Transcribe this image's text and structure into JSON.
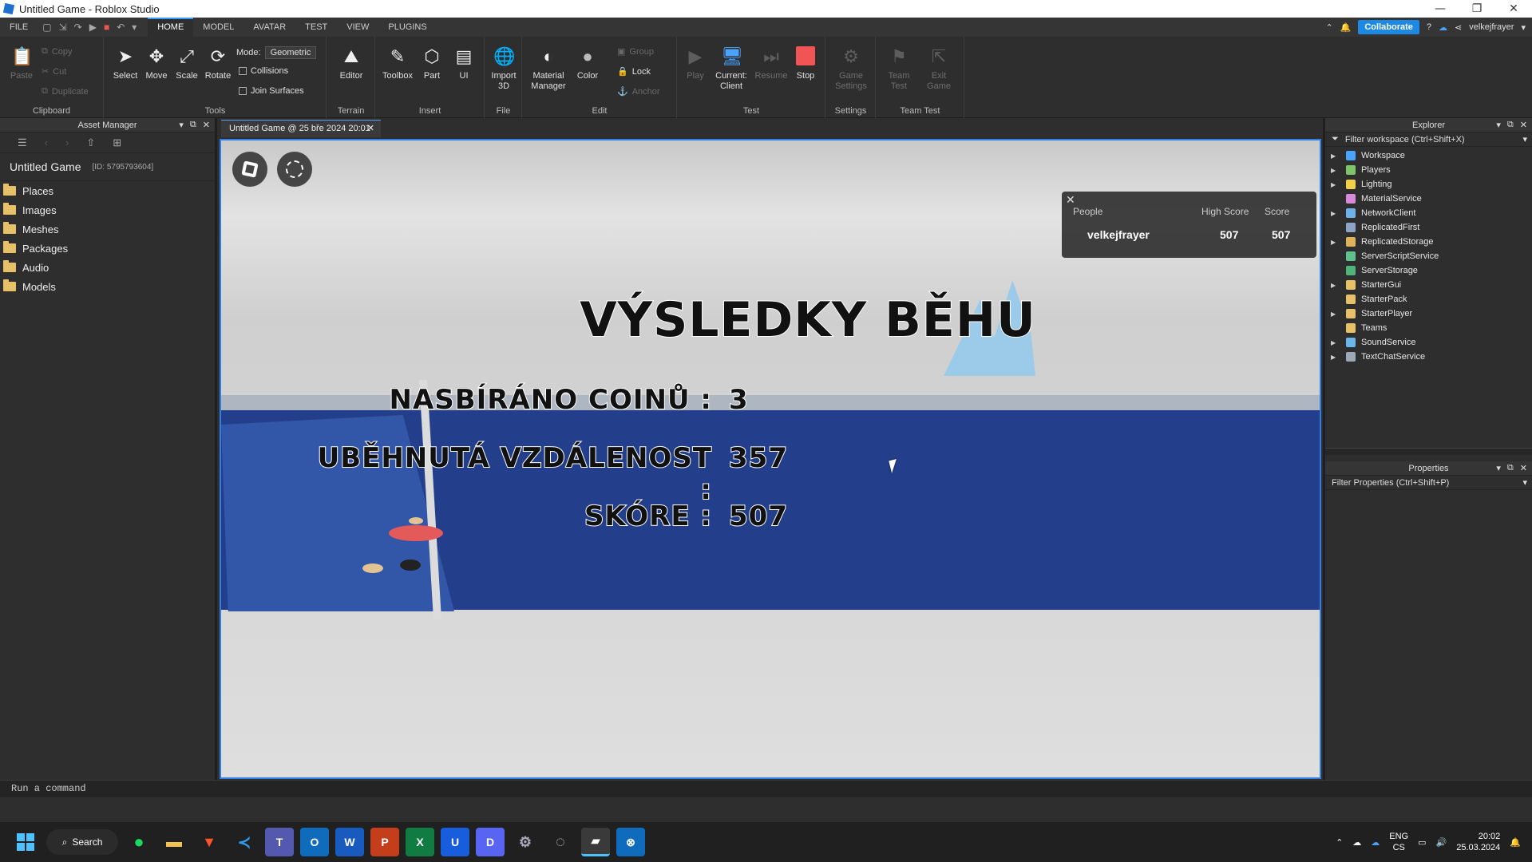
{
  "window": {
    "title": "Untitled Game - Roblox Studio",
    "min": "—",
    "max": "❐",
    "close": "✕"
  },
  "menu": {
    "file": "FILE",
    "tabs": [
      "HOME",
      "MODEL",
      "AVATAR",
      "TEST",
      "VIEW",
      "PLUGINS"
    ],
    "collaborate": "Collaborate",
    "username": "velkejfrayer"
  },
  "ribbon": {
    "clipboard": {
      "label": "Clipboard",
      "paste": "Paste",
      "copy": "Copy",
      "cut": "Cut",
      "duplicate": "Duplicate"
    },
    "tools": {
      "label": "Tools",
      "select": "Select",
      "move": "Move",
      "scale": "Scale",
      "rotate": "Rotate",
      "mode_label": "Mode:",
      "mode_value": "Geometric",
      "collisions": "Collisions",
      "join_surfaces": "Join Surfaces"
    },
    "terrain": {
      "label": "Terrain",
      "editor": "Editor"
    },
    "insert": {
      "label": "Insert",
      "toolbox": "Toolbox",
      "part": "Part",
      "ui": "UI"
    },
    "file": {
      "label": "File",
      "import3d_1": "Import",
      "import3d_2": "3D"
    },
    "edit": {
      "label": "Edit",
      "material1": "Material",
      "material2": "Manager",
      "color": "Color",
      "group": "Group",
      "lock": "Lock",
      "anchor": "Anchor"
    },
    "test": {
      "label": "Test",
      "play": "Play",
      "current1": "Current:",
      "current2": "Client",
      "resume": "Resume",
      "stop": "Stop"
    },
    "settings": {
      "label": "Settings",
      "game1": "Game",
      "game2": "Settings"
    },
    "teamtest": {
      "label": "Team Test",
      "team1": "Team",
      "team2": "Test",
      "exit1": "Exit",
      "exit2": "Game"
    }
  },
  "asset_manager": {
    "title": "Asset Manager",
    "game_name": "Untitled Game",
    "game_id": "[ID: 5795793604]",
    "folders": [
      "Places",
      "Images",
      "Meshes",
      "Packages",
      "Audio",
      "Models"
    ]
  },
  "doc_tab": {
    "label": "Untitled Game @ 25 bře 2024 20:01"
  },
  "game": {
    "title": "VÝSLEDKY BĚHU",
    "stats": [
      {
        "label": "NASBÍRÁNO COINŮ :",
        "value": "3"
      },
      {
        "label": "UBĚHNUTÁ VZDÁLENOST :",
        "value": "357"
      },
      {
        "label": "SKÓRE :",
        "value": "507"
      }
    ],
    "leaderboard": {
      "headers": [
        "People",
        "High Score",
        "Score"
      ],
      "rows": [
        {
          "name": "velkejfrayer",
          "high": "507",
          "score": "507"
        }
      ]
    }
  },
  "explorer": {
    "title": "Explorer",
    "filter": "Filter workspace (Ctrl+Shift+X)",
    "items": [
      {
        "name": "Workspace",
        "arrow": true,
        "color": "#4aa3ff"
      },
      {
        "name": "Players",
        "arrow": true,
        "color": "#7fc46a"
      },
      {
        "name": "Lighting",
        "arrow": true,
        "color": "#f2d04b"
      },
      {
        "name": "MaterialService",
        "arrow": false,
        "color": "#d68ad9"
      },
      {
        "name": "NetworkClient",
        "arrow": true,
        "color": "#6fb0e8"
      },
      {
        "name": "ReplicatedFirst",
        "arrow": false,
        "color": "#8fa3c7"
      },
      {
        "name": "ReplicatedStorage",
        "arrow": true,
        "color": "#e0b35a"
      },
      {
        "name": "ServerScriptService",
        "arrow": false,
        "color": "#5fc28c"
      },
      {
        "name": "ServerStorage",
        "arrow": false,
        "color": "#4fb37a"
      },
      {
        "name": "StarterGui",
        "arrow": true,
        "color": "#e7c06a"
      },
      {
        "name": "StarterPack",
        "arrow": false,
        "color": "#e7c06a"
      },
      {
        "name": "StarterPlayer",
        "arrow": true,
        "color": "#e7c06a"
      },
      {
        "name": "Teams",
        "arrow": false,
        "color": "#e7c06a"
      },
      {
        "name": "SoundService",
        "arrow": true,
        "color": "#6bb6e6"
      },
      {
        "name": "TextChatService",
        "arrow": true,
        "color": "#9ea7b5"
      }
    ]
  },
  "properties": {
    "title": "Properties",
    "filter": "Filter Properties (Ctrl+Shift+P)"
  },
  "command": {
    "placeholder": "Run a command"
  },
  "taskbar": {
    "search": "Search",
    "lang1": "ENG",
    "lang2": "CS",
    "time": "20:02",
    "date": "25.03.2024"
  }
}
